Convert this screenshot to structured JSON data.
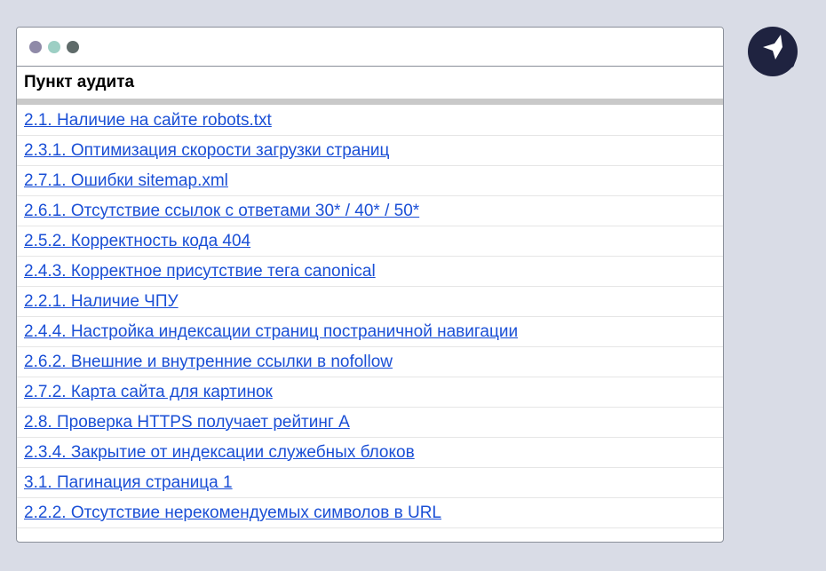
{
  "window": {
    "traffic_lights": [
      "#8f8aa8",
      "#9dcfc4",
      "#5f6b6a"
    ]
  },
  "table": {
    "header": "Пункт аудита",
    "items": [
      "2.1. Наличие на сайте robots.txt",
      "2.3.1. Оптимизация скорости загрузки страниц",
      "2.7.1. Ошибки sitemap.xml",
      "2.6.1. Отсутствие ссылок с ответами 30* / 40* / 50*",
      "2.5.2. Корректность кода 404",
      "2.4.3. Корректное присутствие тега canonical",
      "2.2.1. Наличие ЧПУ",
      "2.4.4. Настройка индексации страниц постраничной навигации",
      "2.6.2. Внешние и внутренние ссылки в nofollow",
      "2.7.2. Карта сайта для картинок",
      "2.8. Проверка HTTPS получает рейтинг А",
      "2.3.4. Закрытие от индексации служебных блоков",
      "3.1. Пагинация страница 1",
      "2.2.2. Отсутствие нерекомендуемых символов в URL"
    ]
  },
  "logo": {
    "icon": "brand-logo-icon",
    "color": "#1f2340"
  },
  "colors": {
    "link": "#1a4fd6",
    "background": "#d9dce6"
  }
}
